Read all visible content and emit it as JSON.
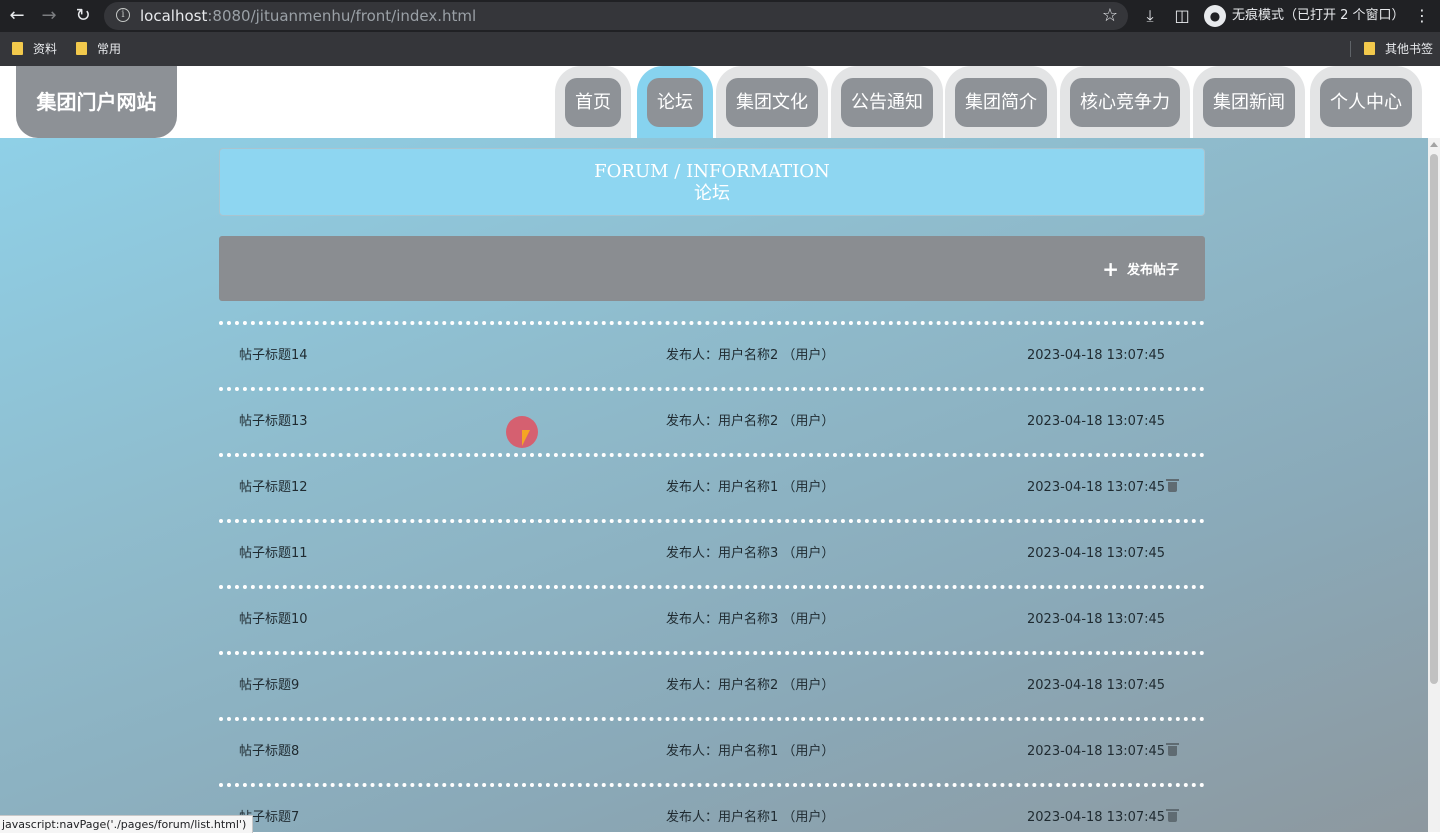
{
  "browser": {
    "url_host": "localhost",
    "url_rest": ":8080/jituanmenhu/front/index.html",
    "incognito_label": "无痕模式（已打开 2 个窗口）",
    "bookmarks": [
      {
        "label": "资料"
      },
      {
        "label": "常用"
      }
    ],
    "other_bookmarks": "其他书签",
    "status_url": "javascript:navPage('./pages/forum/list.html')"
  },
  "site": {
    "logo": "集团门户网站",
    "nav": [
      {
        "label": "首页",
        "active": false
      },
      {
        "label": "论坛",
        "active": true
      },
      {
        "label": "集团文化",
        "active": false
      },
      {
        "label": "公告通知",
        "active": false
      },
      {
        "label": "集团简介",
        "active": false
      },
      {
        "label": "核心竞争力",
        "active": false
      },
      {
        "label": "集团新闻",
        "active": false
      },
      {
        "label": "个人中心",
        "active": false
      }
    ]
  },
  "section": {
    "title_en": "FORUM / INFORMATION",
    "title_cn": "论坛"
  },
  "toolbar": {
    "publish_label": "发布帖子"
  },
  "posts": [
    {
      "title": "帖子标题14",
      "author": "发布人：用户名称2 （用户）",
      "time": "2023-04-18 13:07:45",
      "deletable": false
    },
    {
      "title": "帖子标题13",
      "author": "发布人：用户名称2 （用户）",
      "time": "2023-04-18 13:07:45",
      "deletable": false
    },
    {
      "title": "帖子标题12",
      "author": "发布人：用户名称1 （用户）",
      "time": "2023-04-18 13:07:45",
      "deletable": true
    },
    {
      "title": "帖子标题11",
      "author": "发布人：用户名称3 （用户）",
      "time": "2023-04-18 13:07:45",
      "deletable": false
    },
    {
      "title": "帖子标题10",
      "author": "发布人：用户名称3 （用户）",
      "time": "2023-04-18 13:07:45",
      "deletable": false
    },
    {
      "title": "帖子标题9",
      "author": "发布人：用户名称2 （用户）",
      "time": "2023-04-18 13:07:45",
      "deletable": false
    },
    {
      "title": "帖子标题8",
      "author": "发布人：用户名称1 （用户）",
      "time": "2023-04-18 13:07:45",
      "deletable": true
    },
    {
      "title": "帖子标题7",
      "author": "发布人：用户名称1 （用户）",
      "time": "2023-04-18 13:07:45",
      "deletable": true
    }
  ]
}
